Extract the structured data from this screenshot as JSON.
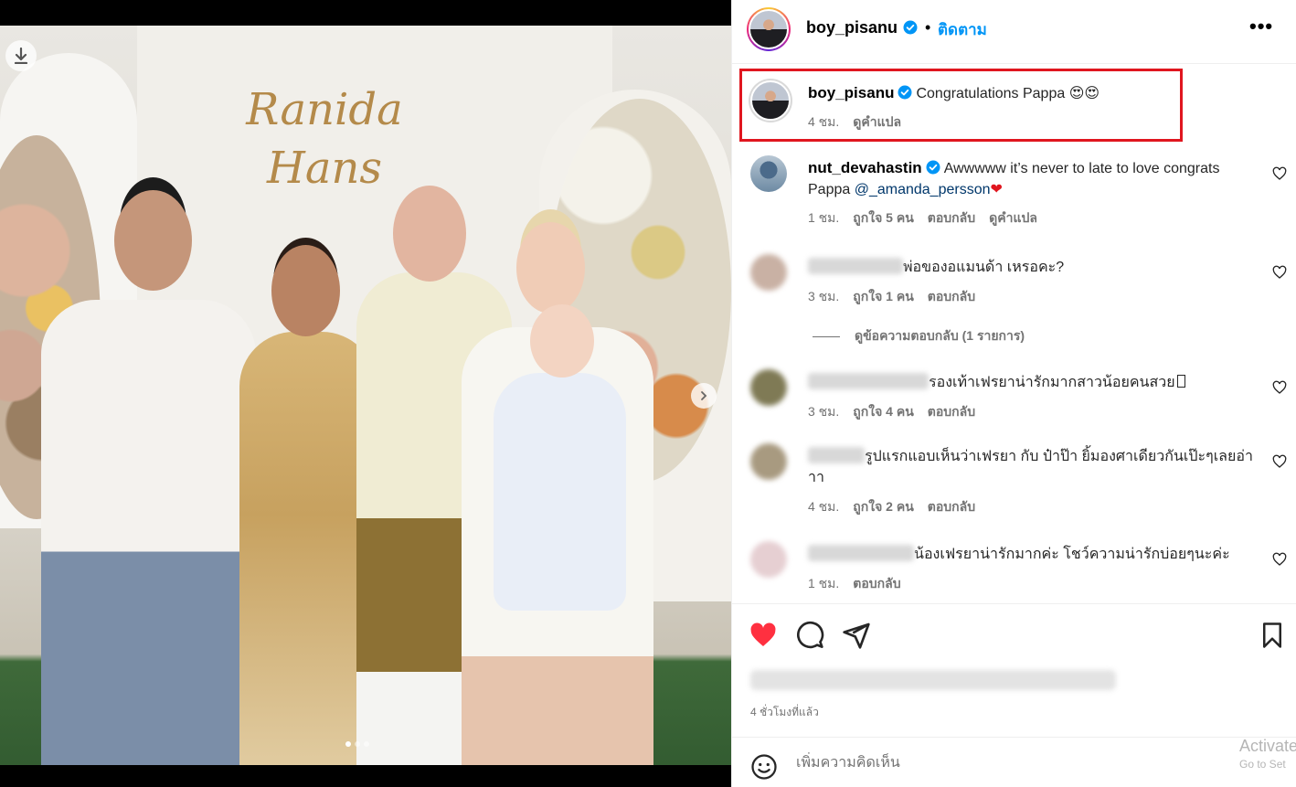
{
  "post": {
    "author": "boy_pisanu",
    "follow_label": "ติดตาม",
    "separator": "•",
    "more_label": "•••",
    "photo_signage": "Ranida Hans",
    "carousel_count": 3,
    "carousel_active": 0
  },
  "caption": {
    "username": "boy_pisanu",
    "text": "Congratulations Pappa 😍😍",
    "time": "4 ชม.",
    "translate": "ดูคำแปล"
  },
  "comments": [
    {
      "username": "nut_devahastin",
      "verified": true,
      "text": "Awwwww it’s never to late to love congrats Pappa ",
      "mention": "@_amanda_persson",
      "suffix": "❤",
      "time": "1 ชม.",
      "likes": "ถูกใจ 5 คน",
      "reply": "ตอบกลับ",
      "translate": "ดูคำแปล"
    },
    {
      "username_hidden": true,
      "text": "พ่อของอแมนด้า เหรอคะ?",
      "time": "3 ชม.",
      "likes": "ถูกใจ 1 คน",
      "reply": "ตอบกลับ",
      "view_replies": "ดูข้อความตอบกลับ (1 รายการ)"
    },
    {
      "username_hidden": true,
      "text": "รองเท้าเฟรยาน่ารักมากสาวน้อยคนสวย",
      "time": "3 ชม.",
      "likes": "ถูกใจ 4 คน",
      "reply": "ตอบกลับ"
    },
    {
      "username_hidden": true,
      "text": "รูปแรกแอบเห็นว่าเฟรยา กับ ป๋าป๊า ยิ้มองศาเดียวกันเป๊ะๆเลยอ่าาา",
      "time": "4 ชม.",
      "likes": "ถูกใจ 2 คน",
      "reply": "ตอบกลับ"
    },
    {
      "username_hidden": true,
      "text": "น้องเฟรยาน่ารักมากค่ะ โชว์ความน่ารักบ่อยๆนะค่ะ",
      "time": "1 ชม.",
      "reply": "ตอบกลับ"
    }
  ],
  "footer": {
    "time_ago": "4 ชั่วโมงที่แล้ว",
    "comment_placeholder": "เพิ่มความคิดเห็น",
    "liked": true
  },
  "watermark": {
    "line1": "Activate",
    "line2": "Go to Set"
  },
  "colors": {
    "accent": "#0095f6",
    "like_red": "#ff3040",
    "highlight_border": "#e0161f",
    "verified": "#0095f6"
  },
  "icons": {
    "like": "heart-icon",
    "comment": "comment-icon",
    "share": "share-icon",
    "save": "bookmark-icon",
    "emoji": "emoji-icon",
    "download": "download-icon",
    "next": "chevron-right-icon",
    "verified": "verified-badge-icon"
  }
}
